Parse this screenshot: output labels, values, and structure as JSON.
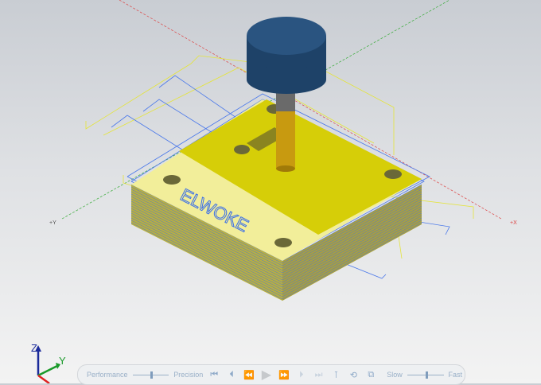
{
  "viewport": {
    "axis_labels": {
      "neg_y": "+Y",
      "pos_x": "+X"
    },
    "engraved_text": "ELWOKE",
    "triad": {
      "z": "Z",
      "y": "Y"
    }
  },
  "toolbar": {
    "quality_left_label": "Performance",
    "quality_right_label": "Precision",
    "quality_value": 0.5,
    "speed_left_label": "Slow",
    "speed_right_label": "Fast",
    "speed_value": 0.5,
    "buttons": [
      {
        "name": "go-to-start",
        "glyph": "⏮"
      },
      {
        "name": "step-back",
        "glyph": "⏴"
      },
      {
        "name": "rewind",
        "glyph": "⏪"
      },
      {
        "name": "play",
        "glyph": "▶"
      },
      {
        "name": "fast-forward",
        "glyph": "⏩"
      },
      {
        "name": "step-forward",
        "glyph": "⏵"
      },
      {
        "name": "go-to-end",
        "glyph": "⏭"
      },
      {
        "name": "toolpath-options",
        "glyph": "⊺"
      },
      {
        "name": "reset",
        "glyph": "⟲"
      },
      {
        "name": "compare",
        "glyph": "⧉"
      }
    ]
  },
  "colors": {
    "stock": "#d4cc10",
    "tool_head": "#244a70",
    "toolpath_blue": "#3a6ee8",
    "toolpath_yellow": "#e6e63c"
  }
}
